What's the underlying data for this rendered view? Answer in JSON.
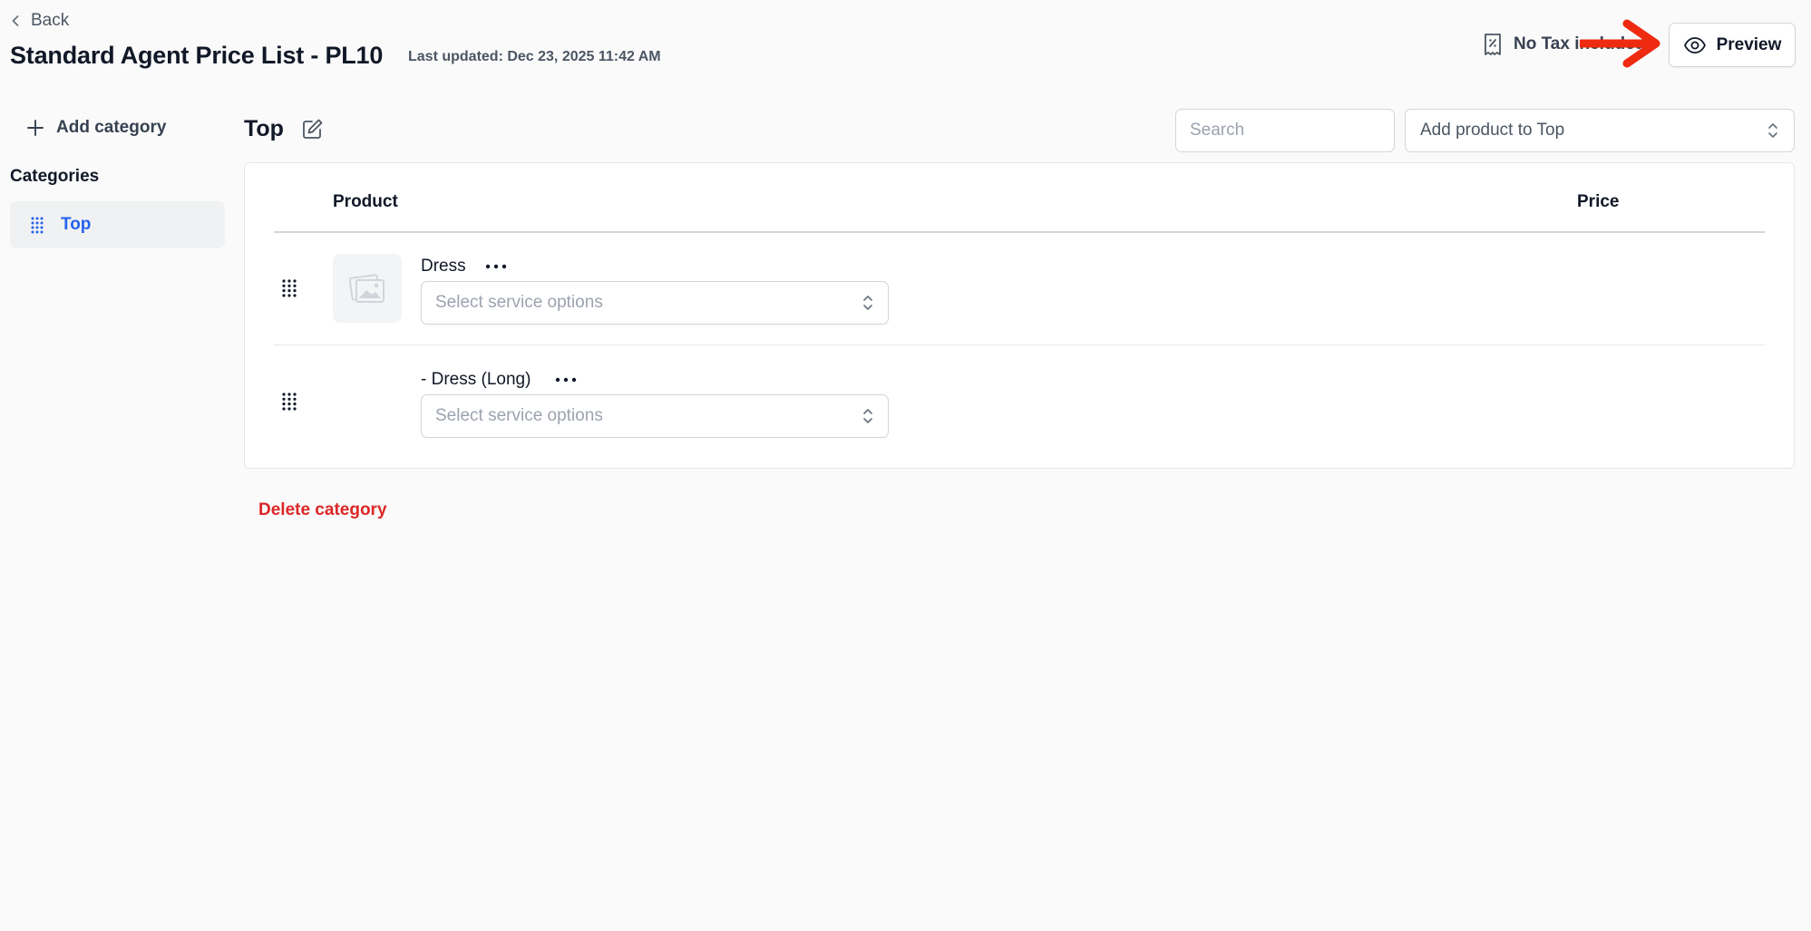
{
  "header": {
    "back_label": "Back",
    "title": "Standard Agent Price List - PL10",
    "last_updated": "Last updated: Dec 23, 2025 11:42 AM",
    "tax_label": "No Tax included",
    "preview_label": "Preview"
  },
  "sidebar": {
    "add_category_label": "Add category",
    "categories_heading": "Categories",
    "items": [
      {
        "label": "Top",
        "active": true
      }
    ]
  },
  "main": {
    "category_title": "Top",
    "search_placeholder": "Search",
    "add_product_placeholder": "Add product to Top",
    "table": {
      "columns": [
        "Product",
        "Price"
      ],
      "rows": [
        {
          "name": "Dress",
          "service_placeholder": "Select service options"
        },
        {
          "name": "- Dress (Long)",
          "service_placeholder": "Select service options"
        }
      ]
    },
    "delete_category_label": "Delete category"
  },
  "colors": {
    "accent": "#2563eb",
    "danger": "#dc2626",
    "annotation_arrow": "#ee2a10",
    "background": "#fafafa"
  },
  "icons": {
    "back": "chevron-left-icon",
    "tax": "receipt-tax-icon",
    "preview": "eye-icon",
    "add": "plus-icon",
    "drag": "drag-grid-icon",
    "edit": "pencil-square-icon",
    "select": "chevron-up-down-icon",
    "thumbnail": "image-placeholder-icon",
    "more": "ellipsis-icon"
  }
}
